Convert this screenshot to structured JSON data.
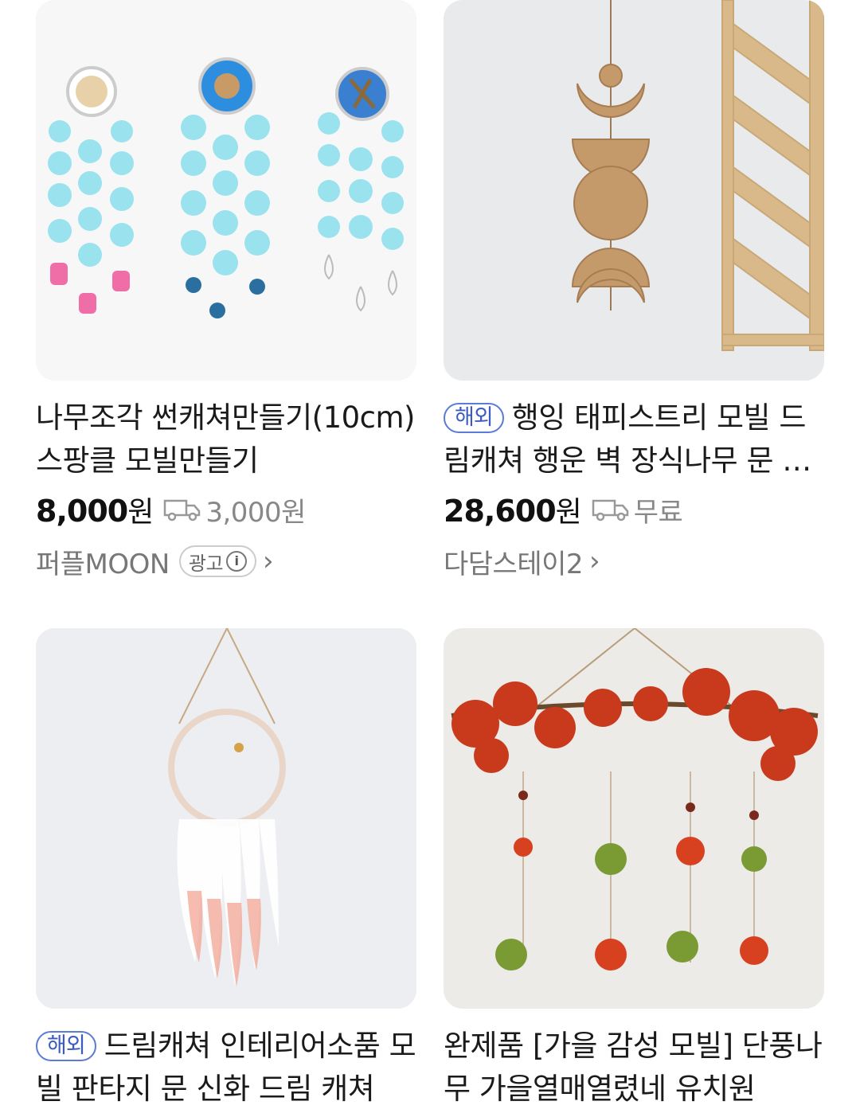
{
  "products": [
    {
      "title": "나무조각 썬캐쳐만들기(10cm) 스팡클 모빌만들기",
      "badge": "",
      "price": "8,000",
      "currency": "원",
      "shipping": "3,000원",
      "seller": "퍼플MOON",
      "ad_label": "광고",
      "image_icon": "sparkle-suncatcher-image"
    },
    {
      "title": "행잉 태피스트리 모빌 드림캐쳐 행운 벽 장식나무 문 모빌",
      "badge": "해외",
      "price": "28,600",
      "currency": "원",
      "shipping": "무료",
      "seller": "다담스테이2",
      "ad_label": "",
      "image_icon": "wooden-moon-phase-image"
    },
    {
      "title": "드림캐쳐 인테리어소품 모빌 판타지 문 신화 드림 캐쳐",
      "badge": "해외",
      "price": "",
      "currency": "",
      "shipping": "",
      "seller": "",
      "ad_label": "",
      "image_icon": "pink-dreamcatcher-image"
    },
    {
      "title": "완제품 [가을 감성 모빌] 단풍나무 가을열매열렸네 유치원",
      "badge": "",
      "price": "",
      "currency": "",
      "shipping": "",
      "seller": "",
      "ad_label": "",
      "image_icon": "autumn-maple-mobile-image"
    }
  ],
  "colors": {
    "badge": "#3b5bbf",
    "muted": "#888888",
    "info_i": "i"
  }
}
